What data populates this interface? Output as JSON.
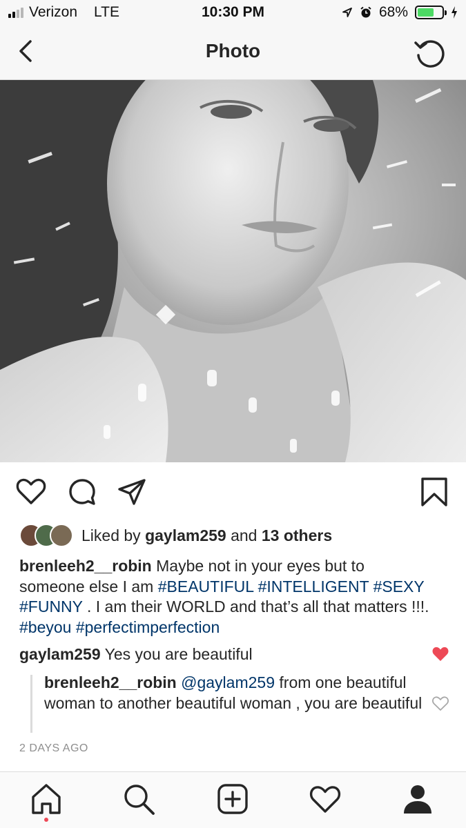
{
  "status_bar": {
    "carrier": "Verizon",
    "network": "LTE",
    "time": "10:30 PM",
    "battery_percent": "68%",
    "battery_level": 0.68,
    "battery_color": "#4cd964"
  },
  "header": {
    "title": "Photo",
    "back_icon": "chevron-left-icon",
    "refresh_icon": "refresh-icon"
  },
  "actions": {
    "like_icon": "heart-outline-icon",
    "comment_icon": "comment-bubble-icon",
    "share_icon": "paper-plane-icon",
    "save_icon": "bookmark-icon"
  },
  "likes": {
    "prefix": "Liked by",
    "user": "gaylam259",
    "conjunction": "and",
    "others": "13 others"
  },
  "caption": {
    "username": "brenleeh2__robin",
    "text_1": "Maybe not in your eyes but to someone else I am",
    "tags_1": "#BEAUTIFUL #INTELLIGENT #SEXY #FUNNY",
    "text_2": ". I am their WORLD and that’s all that matters !!!.",
    "tags_2": "#beyou #perfectimperfection"
  },
  "comment": {
    "username": "gaylam259",
    "text": "Yes you are beautiful",
    "liked": true
  },
  "reply": {
    "username": "brenleeh2__robin",
    "mention": "@gaylam259",
    "text": "from one beautiful woman to another beautiful woman , you are beautiful"
  },
  "time_ago": "2 DAYS AGO",
  "tab_bar": {
    "items": [
      "home-icon",
      "search-icon",
      "add-post-icon",
      "activity-heart-icon",
      "profile-icon"
    ],
    "active": "home-icon"
  },
  "colors": {
    "hashtag": "#003569",
    "like_red": "#ed4956",
    "muted": "#8e8e8e"
  }
}
